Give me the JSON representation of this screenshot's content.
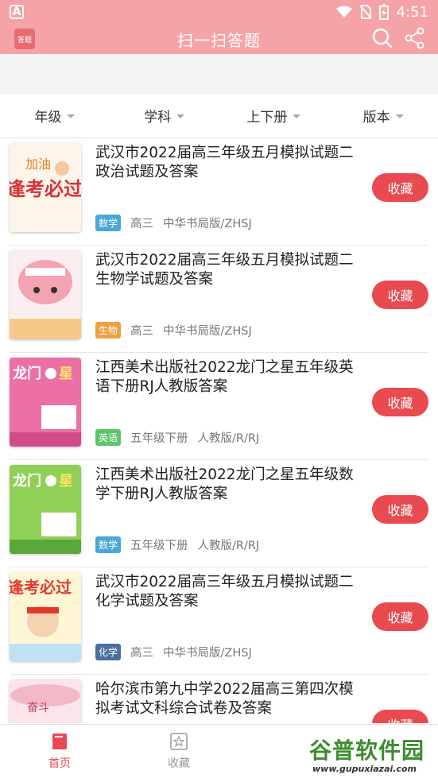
{
  "status_bar": {
    "time": "4:51",
    "left_icon": "A"
  },
  "app_bar": {
    "logo_text": "答题",
    "title": "扫一扫答题"
  },
  "filters": [
    {
      "label": "年级"
    },
    {
      "label": "学科"
    },
    {
      "label": "上下册"
    },
    {
      "label": "版本"
    }
  ],
  "items": [
    {
      "title": "武汉市2022届高三年级五月模拟试题二政治试题及答案",
      "tag": "数学",
      "tag_color": "#4aa7d8",
      "grade": "高三",
      "edition": "中华书局版/ZHSJ",
      "button": "收藏",
      "cover": "cartoon-red"
    },
    {
      "title": "武汉市2022届高三年级五月模拟试题二生物学试题及答案",
      "tag": "生物",
      "tag_color": "#f0a040",
      "grade": "高三",
      "edition": "中华书局版/ZHSJ",
      "button": "收藏",
      "cover": "cartoon-pink"
    },
    {
      "title": "江西美术出版社2022龙门之星五年级英语下册RJ人教版答案",
      "tag": "英语",
      "tag_color": "#5cc46a",
      "grade": "五年级下册",
      "edition": "人教版/R/RJ",
      "button": "收藏",
      "cover": "book-pink"
    },
    {
      "title": "江西美术出版社2022龙门之星五年级数学下册RJ人教版答案",
      "tag": "数学",
      "tag_color": "#4aa7d8",
      "grade": "五年级下册",
      "edition": "人教版/R/RJ",
      "button": "收藏",
      "cover": "book-green"
    },
    {
      "title": "武汉市2022届高三年级五月模拟试题二化学试题及答案",
      "tag": "化学",
      "tag_color": "#4a6fa0",
      "grade": "高三",
      "edition": "中华书局版/ZHSJ",
      "button": "收藏",
      "cover": "cartoon-yellow"
    },
    {
      "title": "哈尔滨市第九中学2022届高三第四次模拟考试文科综合试卷及答案",
      "tag": "",
      "tag_color": "#999999",
      "grade": "",
      "edition": "",
      "button": "收藏",
      "cover": "cartoon-pink2"
    }
  ],
  "bottom_nav": [
    {
      "label": "首页",
      "icon": "book-icon",
      "active": true
    },
    {
      "label": "收藏",
      "icon": "star-box-icon",
      "active": false
    }
  ],
  "watermark": {
    "main": "谷普软件园",
    "url": "www.gupuxiazai.com"
  },
  "colors": {
    "primary": "#f6a3a8",
    "accent": "#e94a4f"
  }
}
